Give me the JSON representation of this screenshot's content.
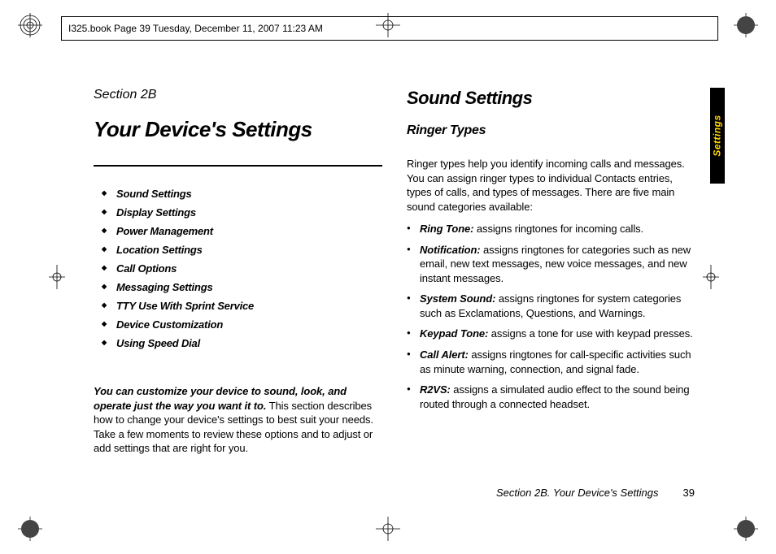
{
  "header_info": "I325.book  Page 39  Tuesday, December 11, 2007  11:23 AM",
  "side_tab": "Settings",
  "left": {
    "section_label": "Section 2B",
    "chapter_title": "Your Device's Settings",
    "toc": [
      "Sound Settings",
      "Display Settings",
      "Power Management",
      "Location Settings",
      "Call Options",
      "Messaging Settings",
      "TTY Use With Sprint Service",
      "Device Customization",
      "Using Speed Dial"
    ],
    "intro_bold": "You can customize your device to sound, look, and operate just the way you want it to.",
    "intro_rest": " This section describes how to change your device's settings to best suit your needs. Take a few moments to review these options and to adjust or add settings that are right for you."
  },
  "right": {
    "heading": "Sound Settings",
    "sub_heading": "Ringer Types",
    "intro": "Ringer types help you identify incoming calls and messages. You can assign ringer types to individual Contacts entries, types of calls, and types of messages. There are five main sound categories available:",
    "bullets": [
      {
        "term": "Ring Tone:",
        "text": " assigns ringtones for incoming calls."
      },
      {
        "term": "Notification:",
        "text": " assigns ringtones for categories such as new email, new text messages, new voice messages, and new instant messages."
      },
      {
        "term": "System Sound:",
        "text": " assigns ringtones for system categories such as Exclamations, Questions, and Warnings."
      },
      {
        "term": "Keypad Tone:",
        "text": " assigns a tone for use with keypad presses."
      },
      {
        "term": "Call Alert:",
        "text": " assigns ringtones for call-specific activities such as minute warning, connection, and signal fade."
      },
      {
        "term": "R2VS:",
        "text": " assigns a simulated audio effect to the sound being routed through a connected headset."
      }
    ]
  },
  "footer": {
    "section": "Section 2B. Your Device's Settings",
    "page": "39"
  }
}
